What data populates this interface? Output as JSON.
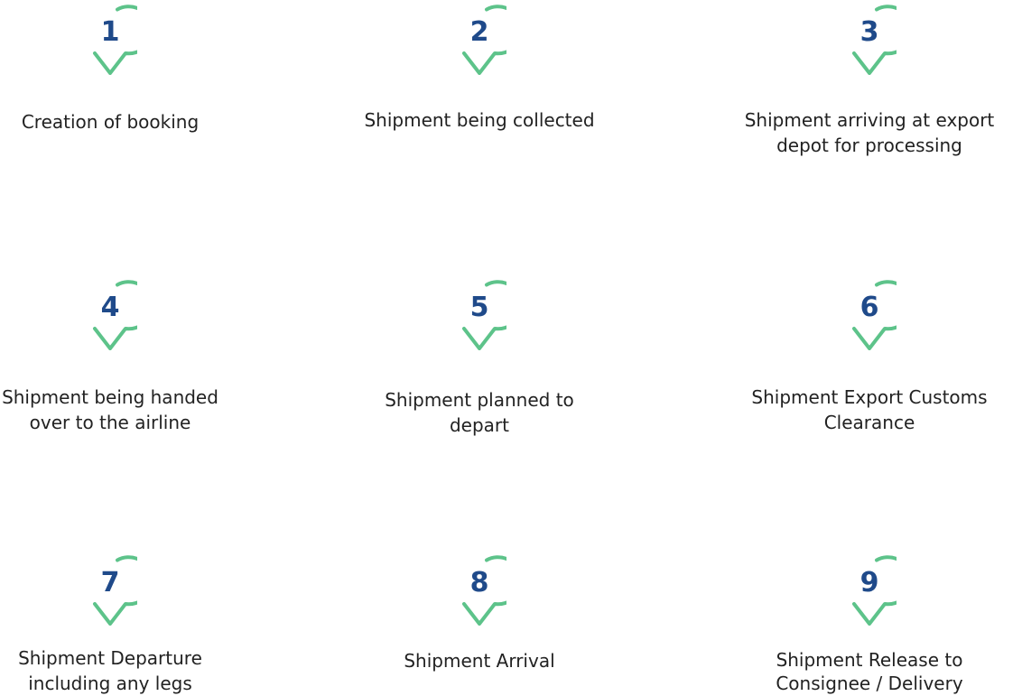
{
  "colors": {
    "pin_stroke": "#5dc38a",
    "number": "#1f4a8a",
    "text": "#222222"
  },
  "steps": [
    {
      "number": "1",
      "lines": [
        "Creation of booking"
      ]
    },
    {
      "number": "2",
      "lines": [
        "Shipment being collected"
      ]
    },
    {
      "number": "3",
      "lines": [
        "Shipment arriving at export",
        "depot for processing"
      ]
    },
    {
      "number": "4",
      "lines": [
        "Shipment being handed",
        "over to the airline"
      ]
    },
    {
      "number": "5",
      "lines": [
        "Shipment planned to",
        "depart"
      ]
    },
    {
      "number": "6",
      "lines": [
        "Shipment Export Customs",
        "Clearance"
      ]
    },
    {
      "number": "7",
      "lines": [
        "Shipment Departure",
        "including any legs"
      ]
    },
    {
      "number": "8",
      "lines": [
        "Shipment Arrival"
      ]
    },
    {
      "number": "9",
      "lines": [
        "Shipment Release to",
        "Consignee / Delivery"
      ]
    }
  ]
}
